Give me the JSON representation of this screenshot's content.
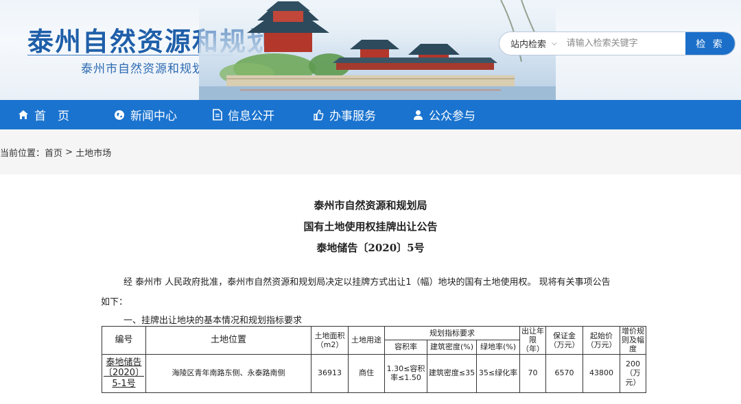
{
  "header": {
    "site_title": "泰州自然资源和规划",
    "site_subtitle": "泰州市自然资源和规划局"
  },
  "search": {
    "scope_label": "站内检索",
    "placeholder": "请输入检索关键字",
    "button_label": "检 索"
  },
  "nav": {
    "items": [
      {
        "label": "首　页",
        "icon": "home-icon"
      },
      {
        "label": "新闻中心",
        "icon": "globe-icon"
      },
      {
        "label": "信息公开",
        "icon": "document-icon"
      },
      {
        "label": "办事服务",
        "icon": "thumbs-up-icon"
      },
      {
        "label": "公众参与",
        "icon": "user-icon"
      }
    ]
  },
  "breadcrumb": {
    "prefix": "当前位置：",
    "home": "首页",
    "separator": " > ",
    "current": "土地市场"
  },
  "article": {
    "title_line1": "泰州市自然资源和规划局",
    "title_line2": "国有土地使用权挂牌出让公告",
    "title_line3": "泰地储告〔2020〕5号",
    "para1": "经 泰州市 人民政府批准，泰州市自然资源和规划局决定以挂牌方式出让1（幅）地块的国有土地使用权。 现将有关事项公告",
    "para1_cont": "如下：",
    "section1": "一、挂牌出让地块的基本情况和规划指标要求"
  },
  "table": {
    "headers": {
      "number": "编号",
      "location": "土地位置",
      "area": "土地面积（m2）",
      "use": "土地用途",
      "planning": "规划指标要求",
      "far": "容积率",
      "density": "建筑密度(%)",
      "green": "绿地率(%)",
      "years": "出让年限（年）",
      "deposit": "保证金（万元）",
      "start_price": "起始价（万元）",
      "increment": "增价规则及幅度"
    },
    "rows": [
      {
        "number": "泰地储告〔2020〕5-1号",
        "location": "海陵区青年南路东侧、永泰路南侧",
        "area": "36913",
        "use": "商住",
        "far": "1.30≤容积率≤1.50",
        "density": "建筑密度≤35",
        "green": "35≤绿化率",
        "years": "70",
        "deposit": "6570",
        "start_price": "43800",
        "increment": "200（万元）"
      }
    ]
  },
  "colors": {
    "nav_bg": "#1a73cf",
    "title_blue": "#1f5fa9",
    "search_button": "#1b6fc9"
  }
}
